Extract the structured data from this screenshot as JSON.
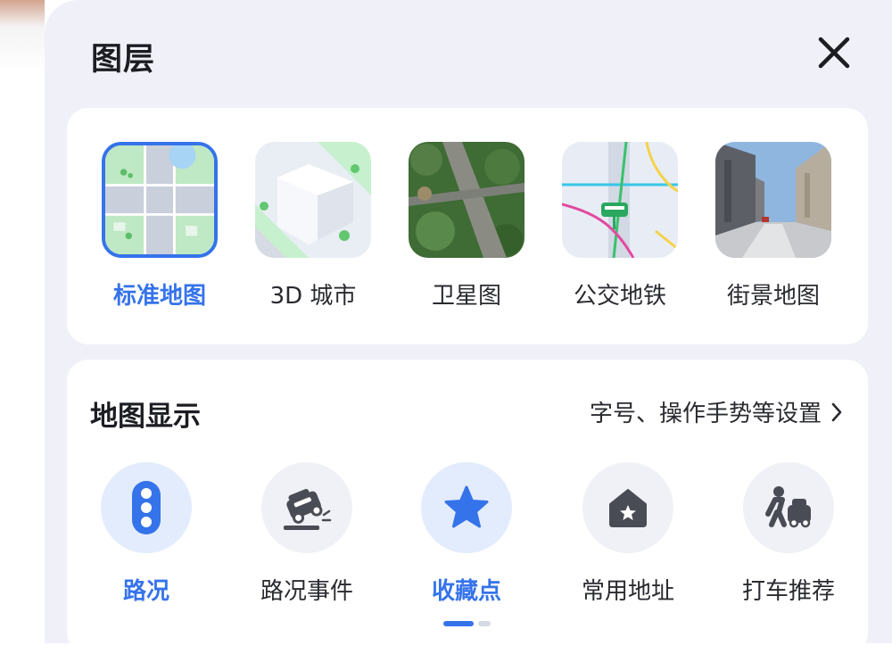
{
  "panel": {
    "title": "图层"
  },
  "layers": {
    "items": [
      {
        "label": "标准地图",
        "selected": true,
        "icon": "standard-map-icon"
      },
      {
        "label": "3D 城市",
        "selected": false,
        "icon": "3d-city-icon"
      },
      {
        "label": "卫星图",
        "selected": false,
        "icon": "satellite-icon"
      },
      {
        "label": "公交地铁",
        "selected": false,
        "icon": "transit-icon"
      },
      {
        "label": "街景地图",
        "selected": false,
        "icon": "street-view-icon"
      }
    ]
  },
  "display": {
    "title": "地图显示",
    "settings_link": "字号、操作手势等设置",
    "items": [
      {
        "label": "路况",
        "active": true,
        "icon": "traffic-light-icon"
      },
      {
        "label": "路况事件",
        "active": false,
        "icon": "road-event-icon"
      },
      {
        "label": "收藏点",
        "active": true,
        "icon": "star-icon"
      },
      {
        "label": "常用地址",
        "active": false,
        "icon": "home-star-icon"
      },
      {
        "label": "打车推荐",
        "active": false,
        "icon": "taxi-recommend-icon"
      }
    ],
    "page_count": 2,
    "current_page": 1
  },
  "colors": {
    "accent": "#3573ea",
    "panel_bg": "#f0f1f8",
    "card_bg": "#ffffff",
    "icon_gray": "#4a4c55"
  }
}
